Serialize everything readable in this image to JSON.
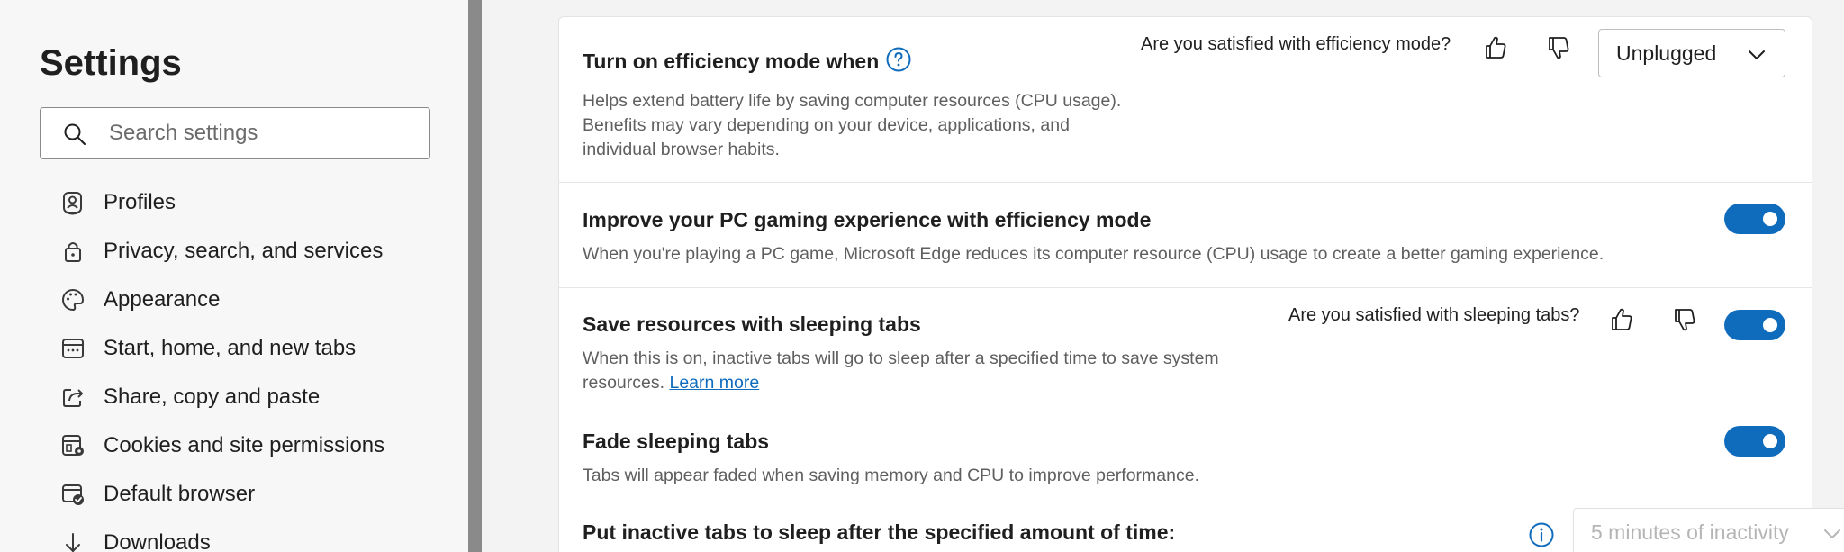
{
  "sidebar": {
    "title": "Settings",
    "search_placeholder": "Search settings",
    "items": [
      {
        "label": "Profiles",
        "icon": "profile-icon"
      },
      {
        "label": "Privacy, search, and services",
        "icon": "lock-icon"
      },
      {
        "label": "Appearance",
        "icon": "palette-icon"
      },
      {
        "label": "Start, home, and new tabs",
        "icon": "window-icon"
      },
      {
        "label": "Share, copy and paste",
        "icon": "share-icon"
      },
      {
        "label": "Cookies and site permissions",
        "icon": "cookies-gear-icon"
      },
      {
        "label": "Default browser",
        "icon": "browser-check-icon"
      },
      {
        "label": "Downloads",
        "icon": "download-arrow-icon"
      }
    ]
  },
  "efficiency": {
    "title": "Turn on efficiency mode when",
    "description": "Helps extend battery life by saving computer resources (CPU usage). Benefits may vary depending on your device, applications, and individual browser habits.",
    "feedback_question": "Are you satisfied with efficiency mode?",
    "dropdown_value": "Unplugged"
  },
  "gaming": {
    "title": "Improve your PC gaming experience with efficiency mode",
    "description": "When you're playing a PC game, Microsoft Edge reduces its computer resource (CPU) usage to create a better gaming experience.",
    "enabled": true
  },
  "sleeping_tabs": {
    "title": "Save resources with sleeping tabs",
    "description": "When this is on, inactive tabs will go to sleep after a specified time to save system resources.",
    "link_text": "Learn more",
    "feedback_question": "Are you satisfied with sleeping tabs?",
    "enabled": true
  },
  "fade_tabs": {
    "title": "Fade sleeping tabs",
    "description": "Tabs will appear faded when saving memory and CPU to improve performance.",
    "enabled": true
  },
  "sleep_after": {
    "title": "Put inactive tabs to sleep after the specified amount of time:",
    "dropdown_value": "5 minutes of inactivity"
  },
  "colors": {
    "accent": "#0f6cbd",
    "splitter": "#8a8a8a"
  }
}
